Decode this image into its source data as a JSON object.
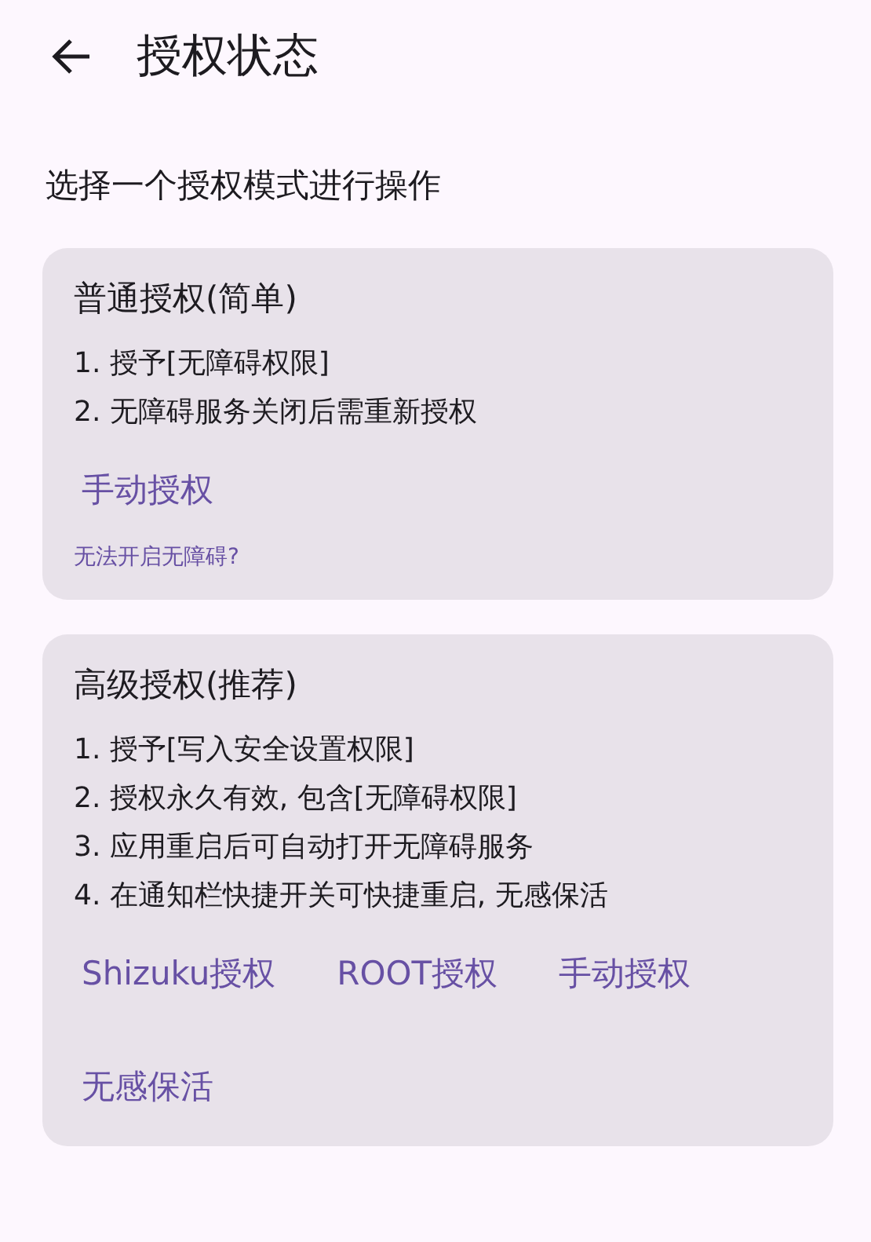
{
  "header": {
    "title": "授权状态"
  },
  "prompt": "选择一个授权模式进行操作",
  "cards": [
    {
      "title": "普通授权(简单)",
      "steps": [
        "1. 授予[无障碍权限]",
        "2. 无障碍服务关闭后需重新授权"
      ],
      "actions": [
        "手动授权"
      ],
      "help_link": "无法开启无障碍?"
    },
    {
      "title": "高级授权(推荐)",
      "steps": [
        "1. 授予[写入安全设置权限]",
        "2. 授权永久有效, 包含[无障碍权限]",
        "3. 应用重启后可自动打开无障碍服务",
        "4. 在通知栏快捷开关可快捷重启, 无感保活"
      ],
      "actions": [
        "Shizuku授权",
        "ROOT授权",
        "手动授权",
        "无感保活"
      ]
    }
  ]
}
